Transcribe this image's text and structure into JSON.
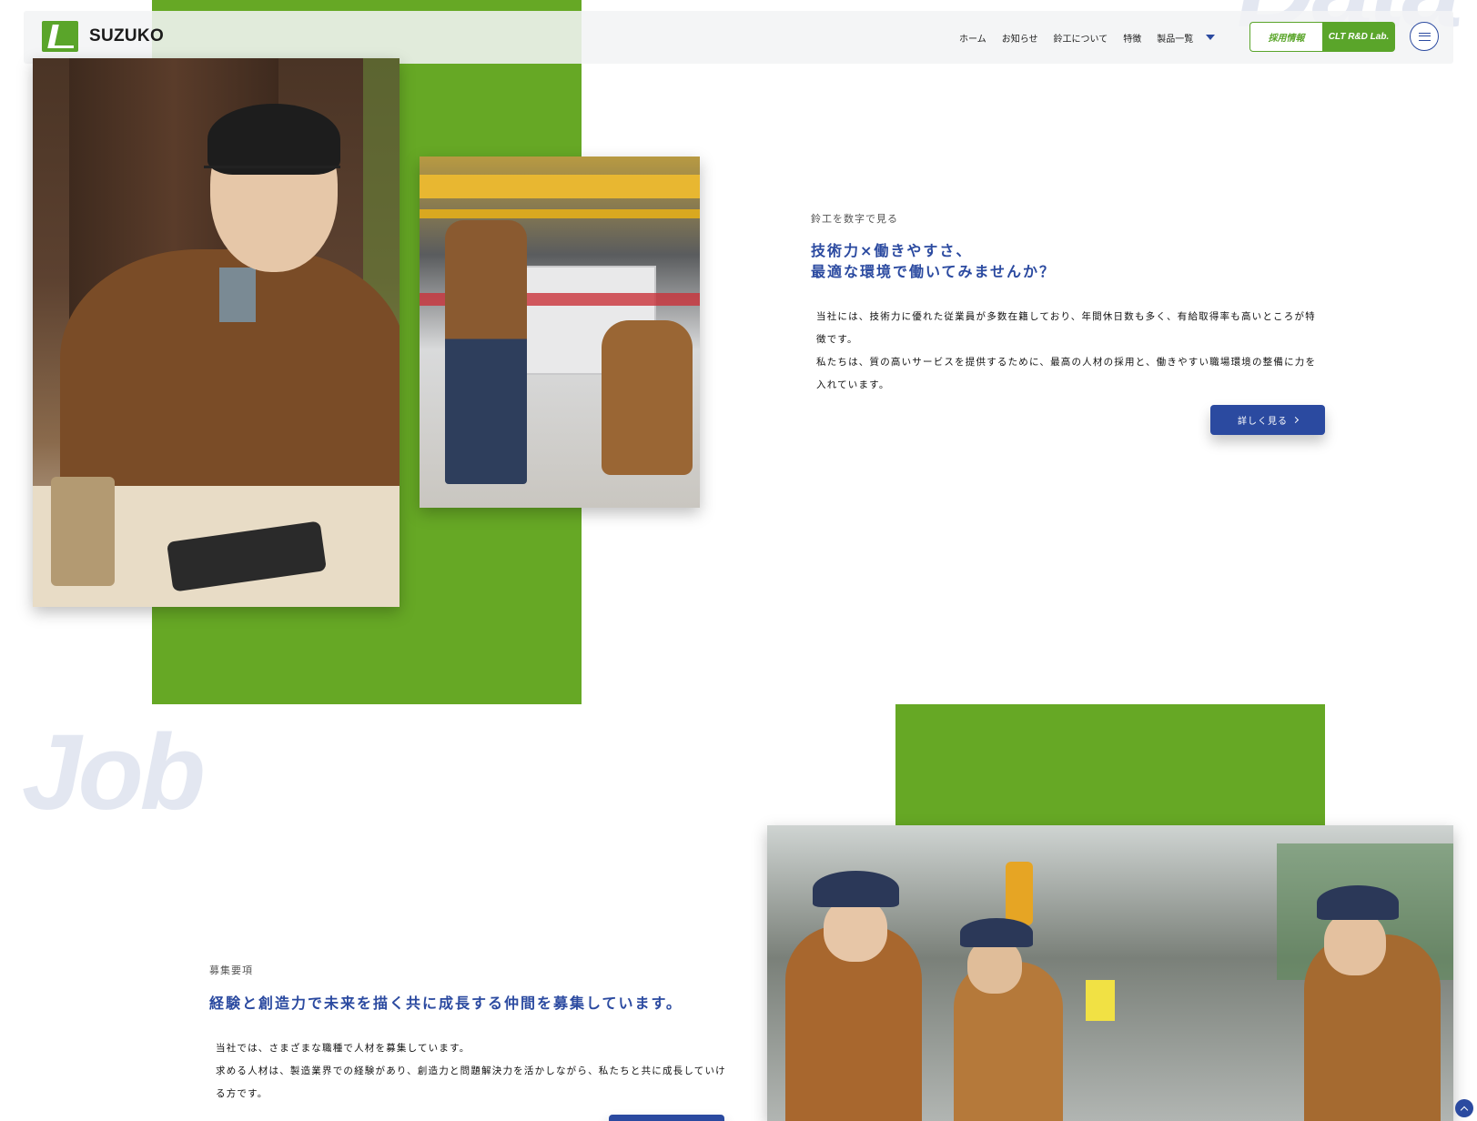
{
  "header": {
    "logo_text": "SUZUKO",
    "nav": [
      {
        "label": "ホーム"
      },
      {
        "label": "お知らせ"
      },
      {
        "label": "鈴工について"
      },
      {
        "label": "特徴"
      },
      {
        "label": "製品一覧"
      }
    ],
    "recruit_button": "採用情報",
    "lab_button": "CLT R&D Lab.",
    "menu_icon": "hamburger-menu-icon"
  },
  "data_section": {
    "label": "鈴工を数字で見る",
    "title_line1": "技術力×働きやすさ、",
    "title_line2": "最適な環境で働いてみませんか？",
    "body_line1": "当社には、技術力に優れた従業員が多数在籍しており、年間休日数も多く、有給取得率も高いところが特徴です。",
    "body_line2": "私たちは、質の高いサービスを提供するために、最高の人材の採用と、働きやすい職場環境の整備に力を入れています。",
    "button": "詳しく見る"
  },
  "job_section": {
    "bg_word": "Job",
    "label": "募集要項",
    "title": "経験と創造力で未来を描く共に成長する仲間を募集しています。",
    "body_line1": "当社では、さまざまな職種で人材を募集しています。",
    "body_line2": "求める人材は、製造業界での経験があり、創造力と問題解決力を活かしながら、私たちと共に成長していける方です。"
  },
  "colors": {
    "brand_green": "#66a825",
    "accent_blue": "#2b4aa0"
  }
}
